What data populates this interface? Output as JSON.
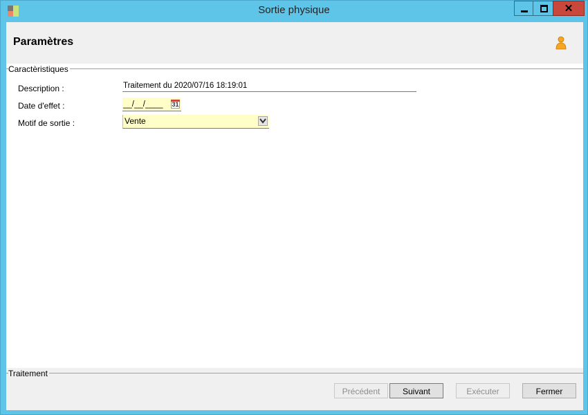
{
  "window": {
    "title": "Sortie physique",
    "controls": {
      "minimize": "minimize",
      "maximize": "maximize",
      "close": "✕"
    }
  },
  "header": {
    "title": "Paramètres",
    "icon": "user-icon"
  },
  "caracteristiques": {
    "label": "Caractèristiques",
    "fields": {
      "description": {
        "label": "Description :",
        "value": "Traitement du 2020/07/16 18:19:01"
      },
      "date_effet": {
        "label": "Date d'effet :",
        "value": "__/__/____",
        "calendar_day": "31"
      },
      "motif": {
        "label": "Motif de sortie :",
        "value": "Vente"
      }
    }
  },
  "traitement": {
    "label": "Traitement",
    "buttons": {
      "precedent": "Précédent",
      "suivant": "Suivant",
      "executer": "Exécuter",
      "fermer": "Fermer"
    }
  },
  "colors": {
    "titlebar": "#5fc5e8",
    "close": "#c9483b",
    "input_highlight": "#fffdc8"
  }
}
